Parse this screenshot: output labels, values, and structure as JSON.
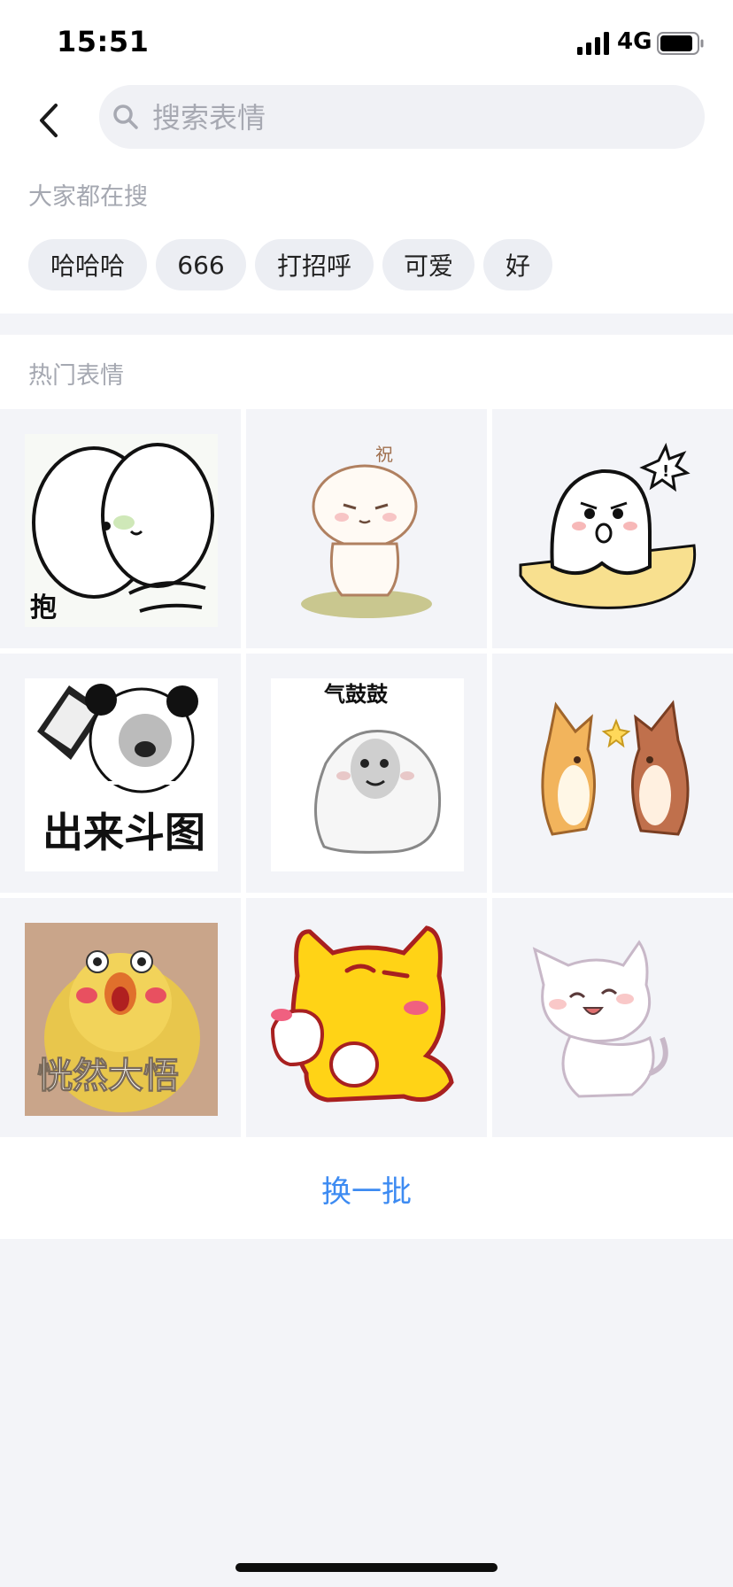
{
  "status_bar": {
    "time": "15:51",
    "network": "4G",
    "icons": [
      "signal-icon",
      "battery-icon"
    ]
  },
  "search": {
    "placeholder": "搜索表情",
    "value": "",
    "icons": [
      "back-arrow-icon",
      "search-icon"
    ]
  },
  "trending": {
    "title": "大家都在搜",
    "tags": [
      "哈哈哈",
      "666",
      "打招呼",
      "可爱",
      "好"
    ]
  },
  "hot": {
    "title": "热门表情",
    "stickers": [
      {
        "name": "sticker-hug-blob",
        "caption": "抱"
      },
      {
        "name": "sticker-white-bear-bless",
        "caption": "祝"
      },
      {
        "name": "sticker-angry-ghost",
        "caption": ""
      },
      {
        "name": "sticker-panda-knife",
        "caption": "出来斗图"
      },
      {
        "name": "sticker-panda-puffed",
        "caption": "气鼓鼓"
      },
      {
        "name": "sticker-corgis-highfive",
        "caption": ""
      },
      {
        "name": "sticker-chick-realization",
        "caption": "恍然大悟"
      },
      {
        "name": "sticker-yellow-cat",
        "caption": ""
      },
      {
        "name": "sticker-white-cat-happy",
        "caption": ""
      }
    ]
  },
  "refresh": {
    "label": "换一批"
  },
  "colors": {
    "accent": "#3d8bf2",
    "page_bg": "#f3f4f8",
    "tag_bg": "#eceef3",
    "muted_text": "#a5a8b1"
  }
}
